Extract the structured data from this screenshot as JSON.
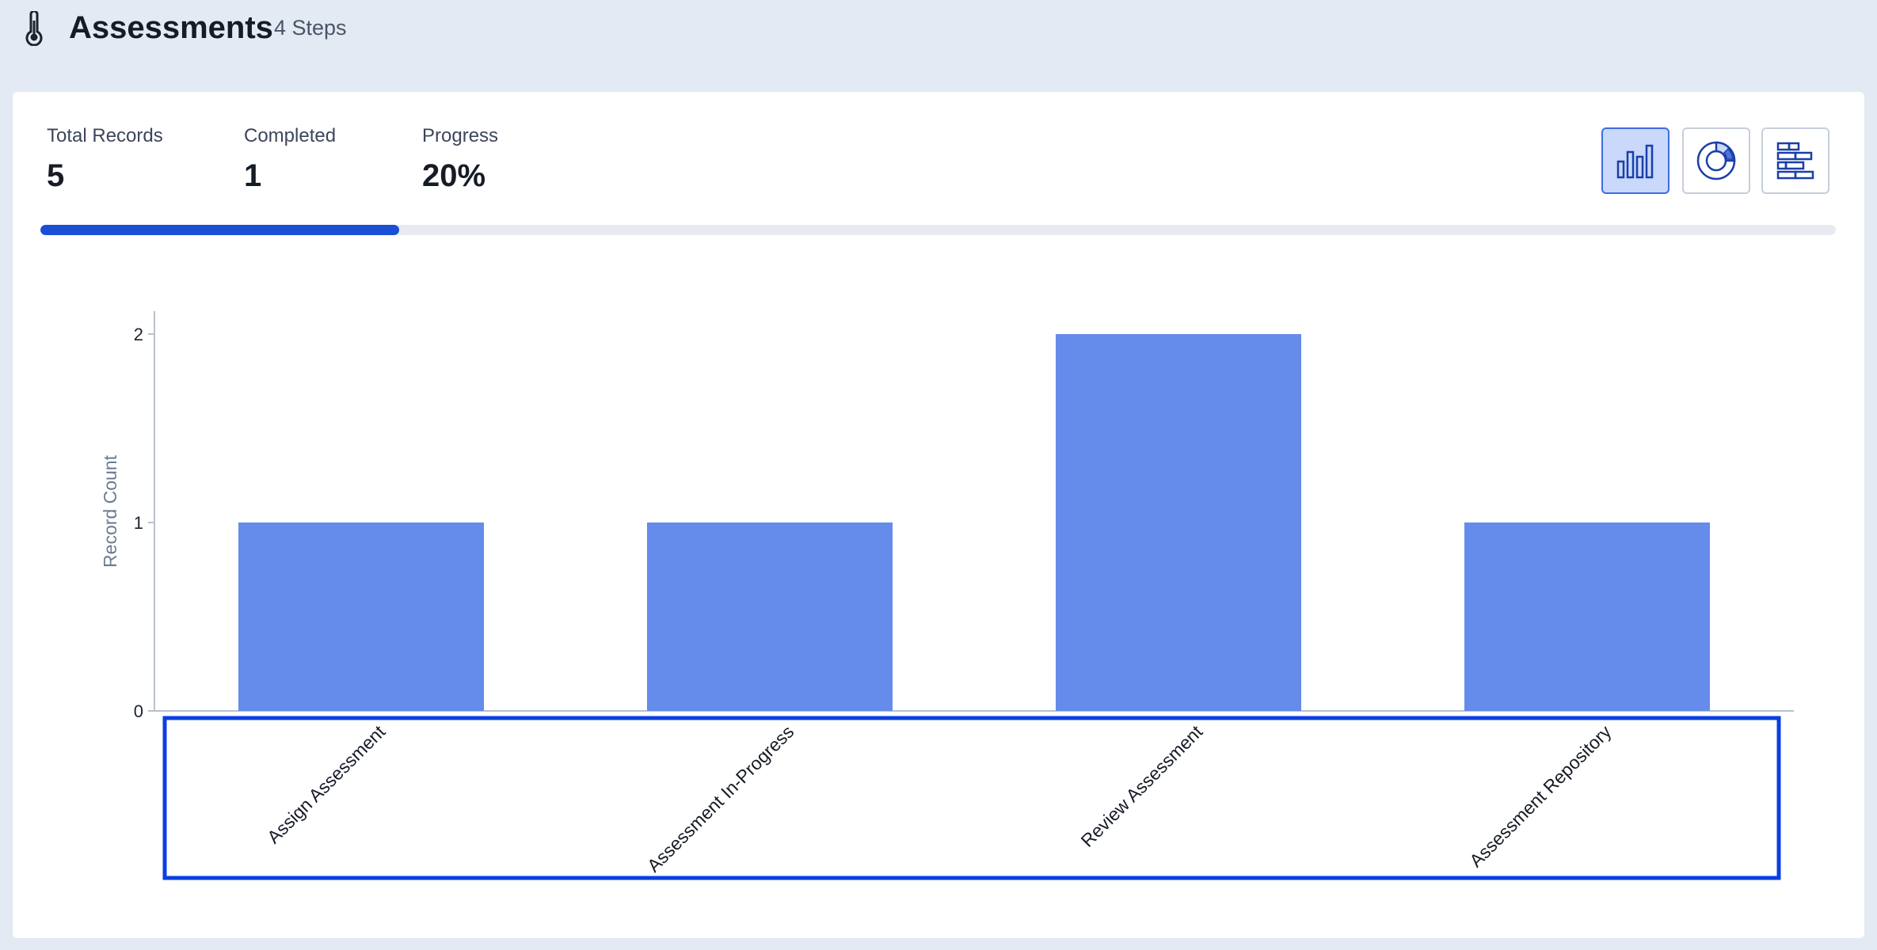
{
  "header": {
    "icon": "thermometer-icon",
    "title": "Assessments",
    "steps": "4 Steps"
  },
  "stats": {
    "total_records_label": "Total Records",
    "total_records_value": "5",
    "completed_label": "Completed",
    "completed_value": "1",
    "progress_label": "Progress",
    "progress_value": "20%",
    "progress_fraction": 0.2
  },
  "view_toggles": [
    {
      "icon": "bar-chart-icon",
      "active": true
    },
    {
      "icon": "donut-chart-icon",
      "active": false
    },
    {
      "icon": "stacked-bar-chart-icon",
      "active": false
    }
  ],
  "colors": {
    "bar": "#658ceb",
    "progress": "#1a4fd6",
    "highlight": "#0a3fe0",
    "background": "#e3eaf3"
  },
  "chart_data": {
    "type": "bar",
    "categories": [
      "Assign Assessment",
      "Assessment In-Progress",
      "Review Assessment",
      "Assessment Repository"
    ],
    "values": [
      1,
      1,
      2,
      1
    ],
    "ylabel": "Record Count",
    "xlabel": "",
    "ylim": [
      0,
      2
    ],
    "yticks": [
      "0",
      "1",
      "2"
    ],
    "grid": false,
    "x_axis_labels_highlighted": true
  }
}
